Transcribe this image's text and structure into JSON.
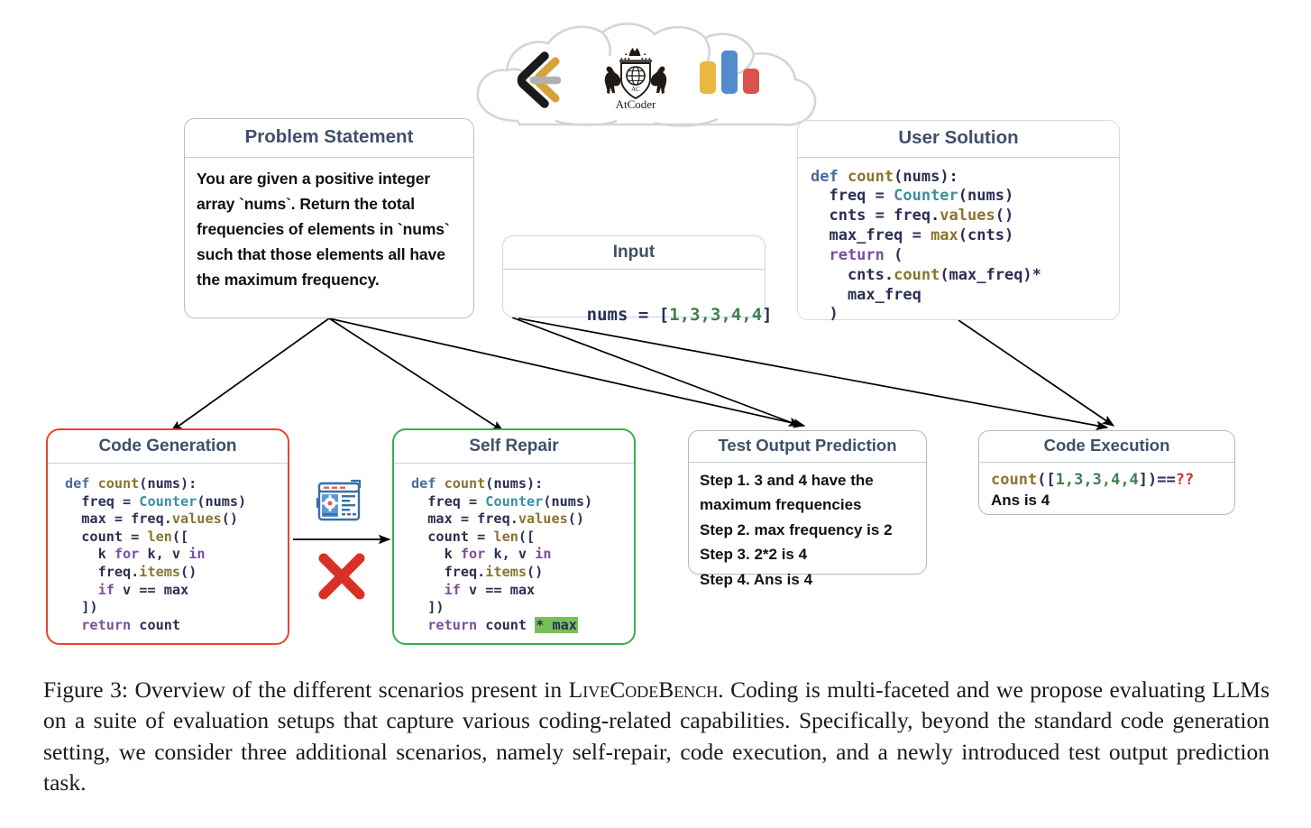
{
  "figure": {
    "logos": [
      {
        "name": "leetcode-logo",
        "label": "LeetCode"
      },
      {
        "name": "atcoder-logo",
        "label": "AtCoder"
      },
      {
        "name": "codeforces-logo",
        "label": "Codeforces"
      }
    ],
    "cloud_label": "coding-platforms-cloud"
  },
  "colors": {
    "title": "#3f5068",
    "border_default": "#b9bfc6",
    "border_code_generation": "#e8452c",
    "border_self_repair": "#35b14a",
    "border_user_solution": "#cfe3c6",
    "border_input": "#c7d6ee",
    "highlight_green": "#79bf58",
    "error_red": "#d2322d",
    "keyword_purple": "#7b4f9d",
    "def_blue": "#4a6c9b",
    "function_olive": "#8a7430",
    "class_teal": "#3f8f9d",
    "number_green": "#3f8050",
    "codeforces_yellow": "#e8b93e",
    "codeforces_blue": "#528ccc",
    "codeforces_red": "#d9534f",
    "leetcode_gold": "#d8a13a",
    "leetcode_black": "#1a1a1a",
    "leetcode_gray": "#b0b0b0"
  },
  "problem_statement": {
    "title": "Problem Statement",
    "text": "You are given a positive integer array `nums`. Return the total frequencies of elements in `nums` such that those elements all have the maximum frequency."
  },
  "input": {
    "title": "Input",
    "var": "nums",
    "eq": " = ",
    "open": "[",
    "values": "1,3,3,4,4",
    "close": "]"
  },
  "user_solution": {
    "title": "User Solution",
    "lines": [
      [
        {
          "t": "def ",
          "c": "kw-def"
        },
        {
          "t": "count",
          "c": "fn"
        },
        {
          "t": "(nums):",
          "c": "var"
        }
      ],
      [
        {
          "t": "  freq = ",
          "c": "var"
        },
        {
          "t": "Counter",
          "c": "cls"
        },
        {
          "t": "(nums)",
          "c": "var"
        }
      ],
      [
        {
          "t": "  cnts = freq.",
          "c": "var"
        },
        {
          "t": "values",
          "c": "fn"
        },
        {
          "t": "()",
          "c": "var"
        }
      ],
      [
        {
          "t": "  max_freq = ",
          "c": "var"
        },
        {
          "t": "max",
          "c": "fn"
        },
        {
          "t": "(cnts)",
          "c": "var"
        }
      ],
      [
        {
          "t": "  return",
          "c": "kw"
        },
        {
          "t": " (",
          "c": "var"
        }
      ],
      [
        {
          "t": "    cnts.",
          "c": "var"
        },
        {
          "t": "count",
          "c": "fn"
        },
        {
          "t": "(max_freq)*",
          "c": "var"
        }
      ],
      [
        {
          "t": "    max_freq",
          "c": "var"
        }
      ],
      [
        {
          "t": "  )",
          "c": "var"
        }
      ]
    ]
  },
  "code_generation": {
    "title": "Code Generation",
    "lines": [
      [
        {
          "t": "def ",
          "c": "kw-def"
        },
        {
          "t": "count",
          "c": "fn"
        },
        {
          "t": "(nums):",
          "c": "var"
        }
      ],
      [
        {
          "t": "  freq = ",
          "c": "var"
        },
        {
          "t": "Counter",
          "c": "cls"
        },
        {
          "t": "(nums)",
          "c": "var"
        }
      ],
      [
        {
          "t": "  max = freq.",
          "c": "var"
        },
        {
          "t": "values",
          "c": "fn"
        },
        {
          "t": "()",
          "c": "var"
        }
      ],
      [
        {
          "t": "  count = ",
          "c": "var"
        },
        {
          "t": "len",
          "c": "fn"
        },
        {
          "t": "([",
          "c": "var"
        }
      ],
      [
        {
          "t": "    k ",
          "c": "var"
        },
        {
          "t": "for",
          "c": "kw"
        },
        {
          "t": " k, v ",
          "c": "var"
        },
        {
          "t": "in",
          "c": "kw"
        }
      ],
      [
        {
          "t": "    freq.",
          "c": "var"
        },
        {
          "t": "items",
          "c": "fn"
        },
        {
          "t": "()",
          "c": "var"
        }
      ],
      [
        {
          "t": "    ",
          "c": "var"
        },
        {
          "t": "if",
          "c": "kw"
        },
        {
          "t": " v == max",
          "c": "var"
        }
      ],
      [
        {
          "t": "  ])",
          "c": "var"
        }
      ],
      [
        {
          "t": "  return",
          "c": "kw"
        },
        {
          "t": " count",
          "c": "var"
        }
      ]
    ]
  },
  "self_repair": {
    "title": "Self Repair",
    "lines": [
      [
        {
          "t": "def ",
          "c": "kw-def"
        },
        {
          "t": "count",
          "c": "fn"
        },
        {
          "t": "(nums):",
          "c": "var"
        }
      ],
      [
        {
          "t": "  freq = ",
          "c": "var"
        },
        {
          "t": "Counter",
          "c": "cls"
        },
        {
          "t": "(nums)",
          "c": "var"
        }
      ],
      [
        {
          "t": "  max = freq.",
          "c": "var"
        },
        {
          "t": "values",
          "c": "fn"
        },
        {
          "t": "()",
          "c": "var"
        }
      ],
      [
        {
          "t": "  count = ",
          "c": "var"
        },
        {
          "t": "len",
          "c": "fn"
        },
        {
          "t": "([",
          "c": "var"
        }
      ],
      [
        {
          "t": "    k ",
          "c": "var"
        },
        {
          "t": "for",
          "c": "kw"
        },
        {
          "t": " k, v ",
          "c": "var"
        },
        {
          "t": "in",
          "c": "kw"
        }
      ],
      [
        {
          "t": "    freq.",
          "c": "var"
        },
        {
          "t": "items",
          "c": "fn"
        },
        {
          "t": "()",
          "c": "var"
        }
      ],
      [
        {
          "t": "    ",
          "c": "var"
        },
        {
          "t": "if",
          "c": "kw"
        },
        {
          "t": " v == max",
          "c": "var"
        }
      ],
      [
        {
          "t": "  ])",
          "c": "var"
        }
      ],
      [
        {
          "t": "  return",
          "c": "kw"
        },
        {
          "t": " count ",
          "c": "var"
        },
        {
          "t": "* max",
          "c": "hl"
        }
      ]
    ],
    "transition_icon": "test-runner-icon",
    "fail_icon": "red-x-icon"
  },
  "test_output_prediction": {
    "title": "Test Output Prediction",
    "steps": [
      "Step 1. 3 and 4  have the maximum frequencies",
      "Step 2. max frequency is 2",
      "Step 3. 2*2 is 4",
      "Step 4. Ans is 4"
    ],
    "bold_answer": "4"
  },
  "code_execution": {
    "title": "Code Execution",
    "call_fn": "count",
    "call_open": "([",
    "call_values": "1,3,3,4,4",
    "call_close": "])",
    "eq": "==",
    "unknown": "??",
    "answer_prefix": "Ans is ",
    "answer": "4"
  },
  "caption": {
    "label": "Figure 3:",
    "part1": " Overview of the different scenarios present in ",
    "benchmark": "LiveCodeBench",
    "part2": ". Coding is multi-faceted and we propose evaluating LLMs on a suite of evaluation setups that capture various coding-related capabilities. Specifically, beyond the standard code generation setting, we consider three additional scenarios, namely self-repair, code execution, and a newly introduced test output prediction task."
  }
}
